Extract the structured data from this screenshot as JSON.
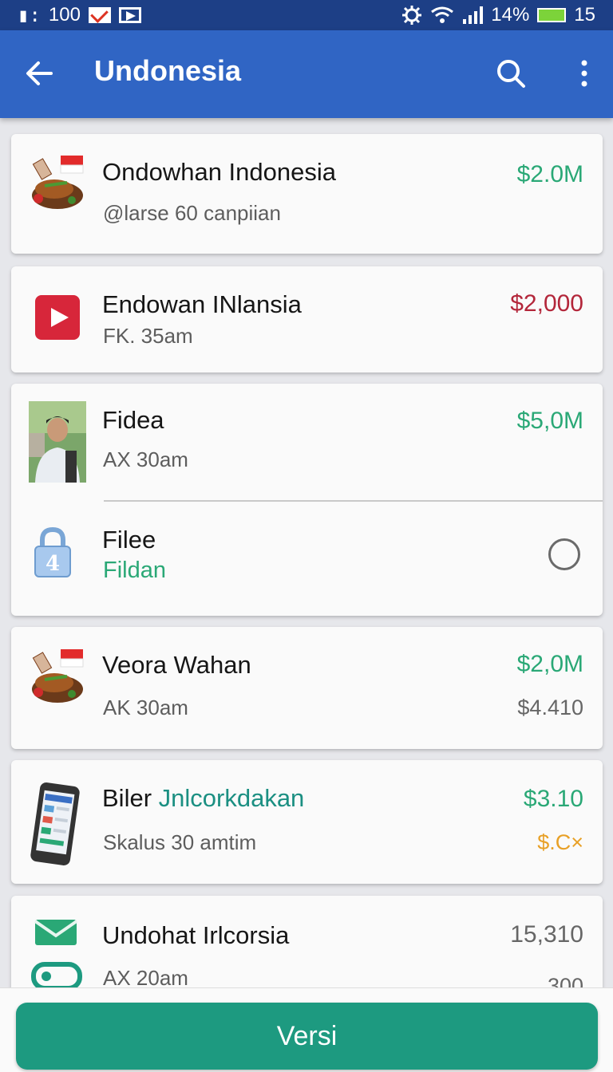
{
  "status_bar": {
    "left_text": "100",
    "battery": "14%",
    "right_text": "15"
  },
  "app_bar": {
    "title": "Undonesia",
    "back_icon": "arrow-back-icon",
    "search_icon": "search-icon",
    "more_icon": "more-vertical-icon"
  },
  "items": [
    {
      "title": "Ondowhan Indonesia",
      "subtitle": "@larse 60 canpiian",
      "amount": "$2.0M",
      "amount_color": "#2aa876",
      "icon": "food-flag-icon"
    },
    {
      "title": "Endowan INlansia",
      "subtitle": "FK. 35am",
      "amount": "$2,000",
      "amount_color": "#b3263a",
      "icon": "play-icon"
    },
    {
      "title": "Fidea",
      "subtitle": "AX 30am",
      "amount": "$5,0M",
      "amount_color": "#2aa876",
      "icon": "avatar-photo"
    },
    {
      "title": "Filee",
      "subtitle": "Fildan",
      "icon": "lock-icon",
      "lock_digit": "4"
    },
    {
      "title": "Veora Wahan",
      "subtitle": "AK 30am",
      "amount": "$2,0M",
      "amount_color": "#2aa876",
      "amount2": "$4.410",
      "icon": "food-flag-icon"
    },
    {
      "title_plain": "Biler",
      "title_highlight": "Jnlcorkdakan",
      "subtitle": "Skalus 30 amtim",
      "amount": "$3.10",
      "amount_color": "#2aa876",
      "amount2": "$.C×",
      "amount2_color": "#e8a026",
      "icon": "phone-icon"
    },
    {
      "title": "Undohat Irlcorsia",
      "subtitle": "AX 20am",
      "amount": "15,310",
      "amount_color": "#666666",
      "amount2": "300",
      "icon": "mail-ticket-icon"
    }
  ],
  "primary_button": {
    "label": "Versi"
  },
  "colors": {
    "app_bar": "#3065c4",
    "status_bar": "#1d3f86",
    "accent_green": "#1d9a80"
  }
}
